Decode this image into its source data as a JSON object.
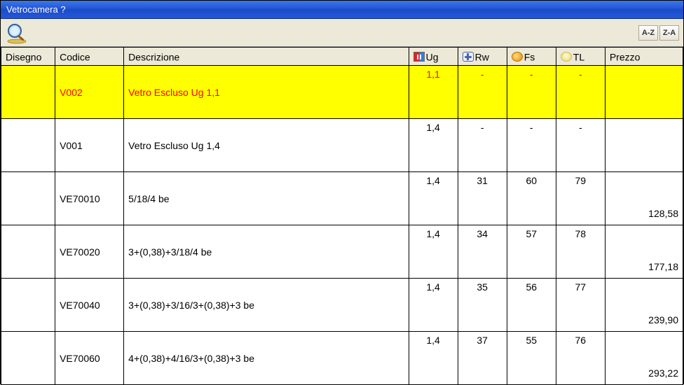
{
  "window": {
    "title": "Vetrocamera ?"
  },
  "toolbar": {
    "sort_az": "A-Z",
    "sort_za": "Z-A"
  },
  "columns": {
    "disegno": "Disegno",
    "codice": "Codice",
    "descrizione": "Descrizione",
    "ug": "Ug",
    "rw": "Rw",
    "fs": "Fs",
    "tl": "TL",
    "prezzo": "Prezzo"
  },
  "rows": [
    {
      "selected": true,
      "disegno": "",
      "codice": "V002",
      "descrizione": "Vetro Escluso Ug 1,1",
      "ug": "1,1",
      "rw": "-",
      "fs": "-",
      "tl": "-",
      "prezzo": ""
    },
    {
      "selected": false,
      "disegno": "",
      "codice": "V001",
      "descrizione": "Vetro Escluso Ug 1,4",
      "ug": "1,4",
      "rw": "-",
      "fs": "-",
      "tl": "-",
      "prezzo": ""
    },
    {
      "selected": false,
      "disegno": "",
      "codice": "VE70010",
      "descrizione": "5/18/4 be",
      "ug": "1,4",
      "rw": "31",
      "fs": "60",
      "tl": "79",
      "prezzo": "128,58"
    },
    {
      "selected": false,
      "disegno": "",
      "codice": "VE70020",
      "descrizione": "3+(0,38)+3/18/4 be",
      "ug": "1,4",
      "rw": "34",
      "fs": "57",
      "tl": "78",
      "prezzo": "177,18"
    },
    {
      "selected": false,
      "disegno": "",
      "codice": "VE70040",
      "descrizione": "3+(0,38)+3/16/3+(0,38)+3 be",
      "ug": "1,4",
      "rw": "35",
      "fs": "56",
      "tl": "77",
      "prezzo": "239,90"
    },
    {
      "selected": false,
      "disegno": "",
      "codice": "VE70060",
      "descrizione": "4+(0,38)+4/16/3+(0,38)+3 be",
      "ug": "1,4",
      "rw": "37",
      "fs": "55",
      "tl": "76",
      "prezzo": "293,22"
    }
  ]
}
